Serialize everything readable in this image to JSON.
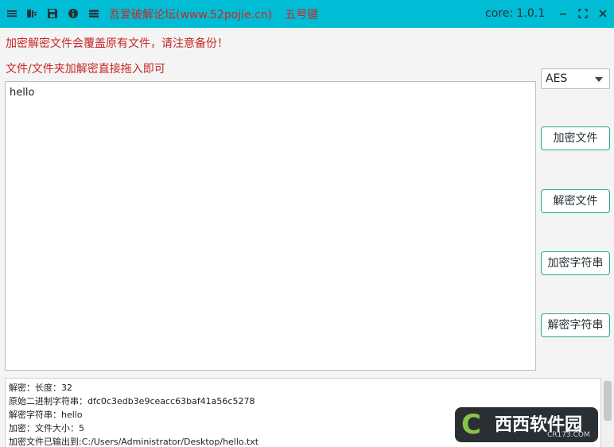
{
  "titlebar": {
    "title": "吾爱破解论坛(www.52pojie.cn)",
    "subtitle": "五号键",
    "version": "core: 1.0.1",
    "icons": [
      "menu-icon",
      "book-icon",
      "save-icon",
      "info-icon",
      "list-icon"
    ],
    "window_controls": [
      "minimize-icon",
      "maximize-icon",
      "close-icon"
    ]
  },
  "colors": {
    "titlebar_bg": "#00bcd4",
    "warning_text": "#c62828",
    "button_border": "#26a69a"
  },
  "notices": {
    "warning": "加密解密文件会覆盖原有文件，请注意备份！",
    "drag_hint": "文件/文件夹加解密直接拖入即可"
  },
  "editor": {
    "value": "hello"
  },
  "algorithm": {
    "selected": "AES"
  },
  "buttons": {
    "encrypt_file": "加密文件",
    "decrypt_file": "解密文件",
    "encrypt_string": "加密字符串",
    "decrypt_string": "解密字符串"
  },
  "log": {
    "lines": [
      "解密：长度：32",
      "原始二进制字符串：dfc0c3edb3e9ceacc63baf41a56c5278",
      "解密字符串：hello",
      "加密：文件大小：5",
      "加密文件已输出到:C:/Users/Administrator/Desktop/hello.txt"
    ]
  },
  "watermark": {
    "letter": "C",
    "main": "西西软件园",
    "sub": "CR173.COM"
  }
}
